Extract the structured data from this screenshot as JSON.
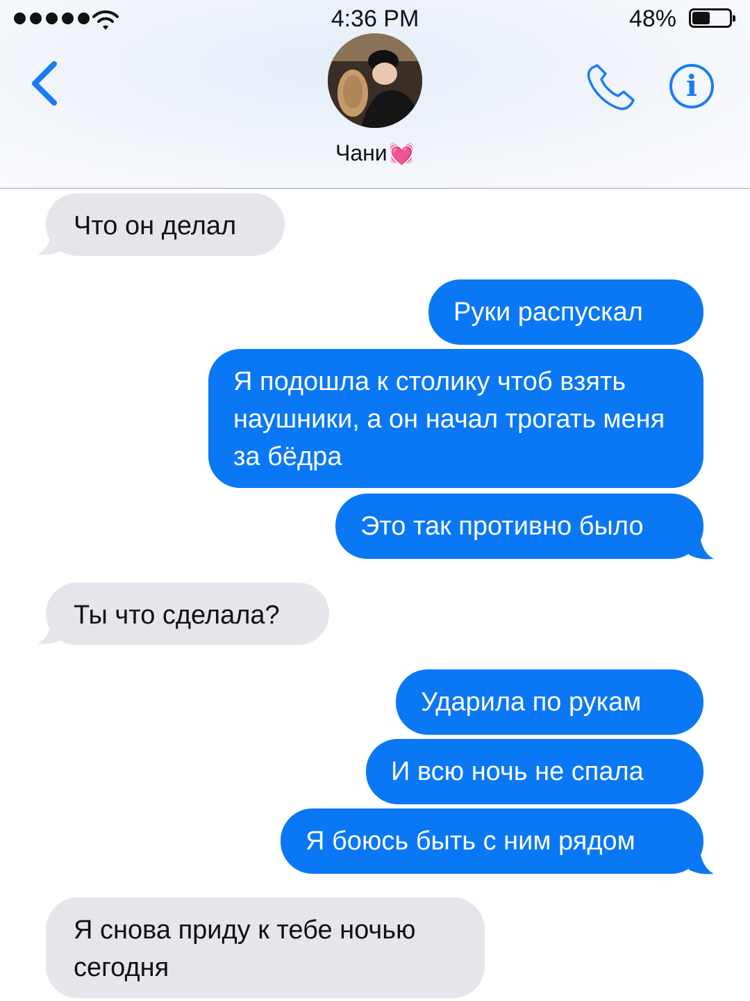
{
  "status_bar": {
    "time": "4:36 PM",
    "battery_percent": "48%",
    "battery_level": 0.48,
    "signal_bars": 5,
    "wifi_icon": "wifi-icon"
  },
  "header": {
    "back_icon": "chevron-left-icon",
    "contact_name": "Чани",
    "contact_emoji": "💓",
    "call_icon": "phone-icon",
    "info_label": "i"
  },
  "colors": {
    "sent_bubble": "#0a78f5",
    "received_bubble": "#e6e5eb",
    "accent": "#1a7cf5"
  },
  "messages": [
    {
      "direction": "received",
      "text": "Что он делал"
    },
    {
      "direction": "sent",
      "text": "Руки распускал"
    },
    {
      "direction": "sent",
      "text": "Я подошла к столику чтоб взять наушники, а он начал трогать меня за бёдра"
    },
    {
      "direction": "sent",
      "text": "Это так противно было"
    },
    {
      "direction": "received",
      "text": "Ты что сделала?"
    },
    {
      "direction": "sent",
      "text": "Ударила по рукам"
    },
    {
      "direction": "sent",
      "text": "И всю ночь не спала"
    },
    {
      "direction": "sent",
      "text": "Я боюсь быть с ним рядом"
    },
    {
      "direction": "received",
      "text": "Я снова приду к тебе ночью сегодня"
    }
  ]
}
